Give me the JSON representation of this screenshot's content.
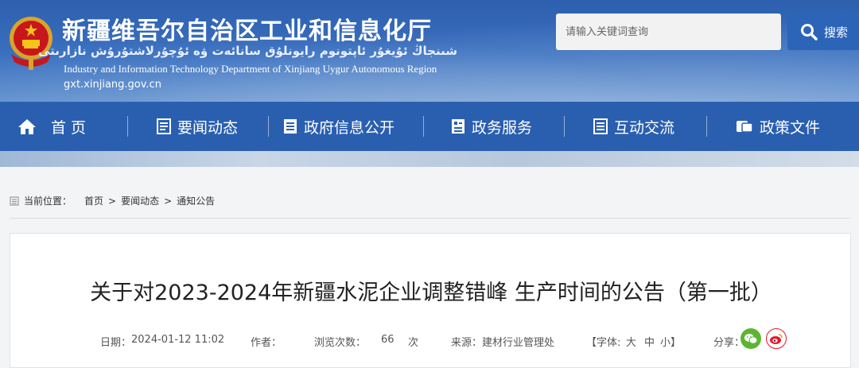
{
  "header": {
    "title_cn": "新疆维吾尔自治区工业和信息化厅",
    "title_ug": "شىنجاڭ ئۇيغۇر ئاپتونوم رايونلۇق سانائەت ۋە ئۇچۇرلاشتۇرۇش نازارىتى",
    "title_en": "Industry and Information Technology Department of Xinjiang Uygur Autonomous Region",
    "domain": "gxt.xinjiang.gov.cn"
  },
  "search": {
    "placeholder": "请输入关键词查询",
    "button_label": "搜索"
  },
  "nav": {
    "items": [
      {
        "label": "首 页",
        "icon": "home-icon"
      },
      {
        "label": "要闻动态",
        "icon": "news-icon"
      },
      {
        "label": "政府信息公开",
        "icon": "info-icon"
      },
      {
        "label": "政务服务",
        "icon": "service-icon"
      },
      {
        "label": "互动交流",
        "icon": "interaction-icon"
      },
      {
        "label": "政策文件",
        "icon": "policy-icon"
      }
    ]
  },
  "breadcrumb": {
    "label": "当前位置：",
    "items": [
      "首页",
      "要闻动态",
      "通知公告"
    ],
    "separator": ">"
  },
  "article": {
    "title": "关于对2023-2024年新疆水泥企业调整错峰 生产时间的公告（第一批）",
    "date_label": "日期：",
    "date": "2024-01-12 11:02",
    "author_label": "作者：",
    "views_label": "浏览次数：",
    "views": "66",
    "views_unit": "次",
    "source_label": "来源：",
    "source": "建材行业管理处",
    "font_label": "【字体:",
    "font_large": "大",
    "font_medium": "中",
    "font_small": "小】",
    "share_label": "分享："
  },
  "colors": {
    "nav_bg": "#2a5fb0",
    "search_btn": "#2c64b8",
    "wechat": "#5cb531",
    "weibo": "#e6162d"
  }
}
